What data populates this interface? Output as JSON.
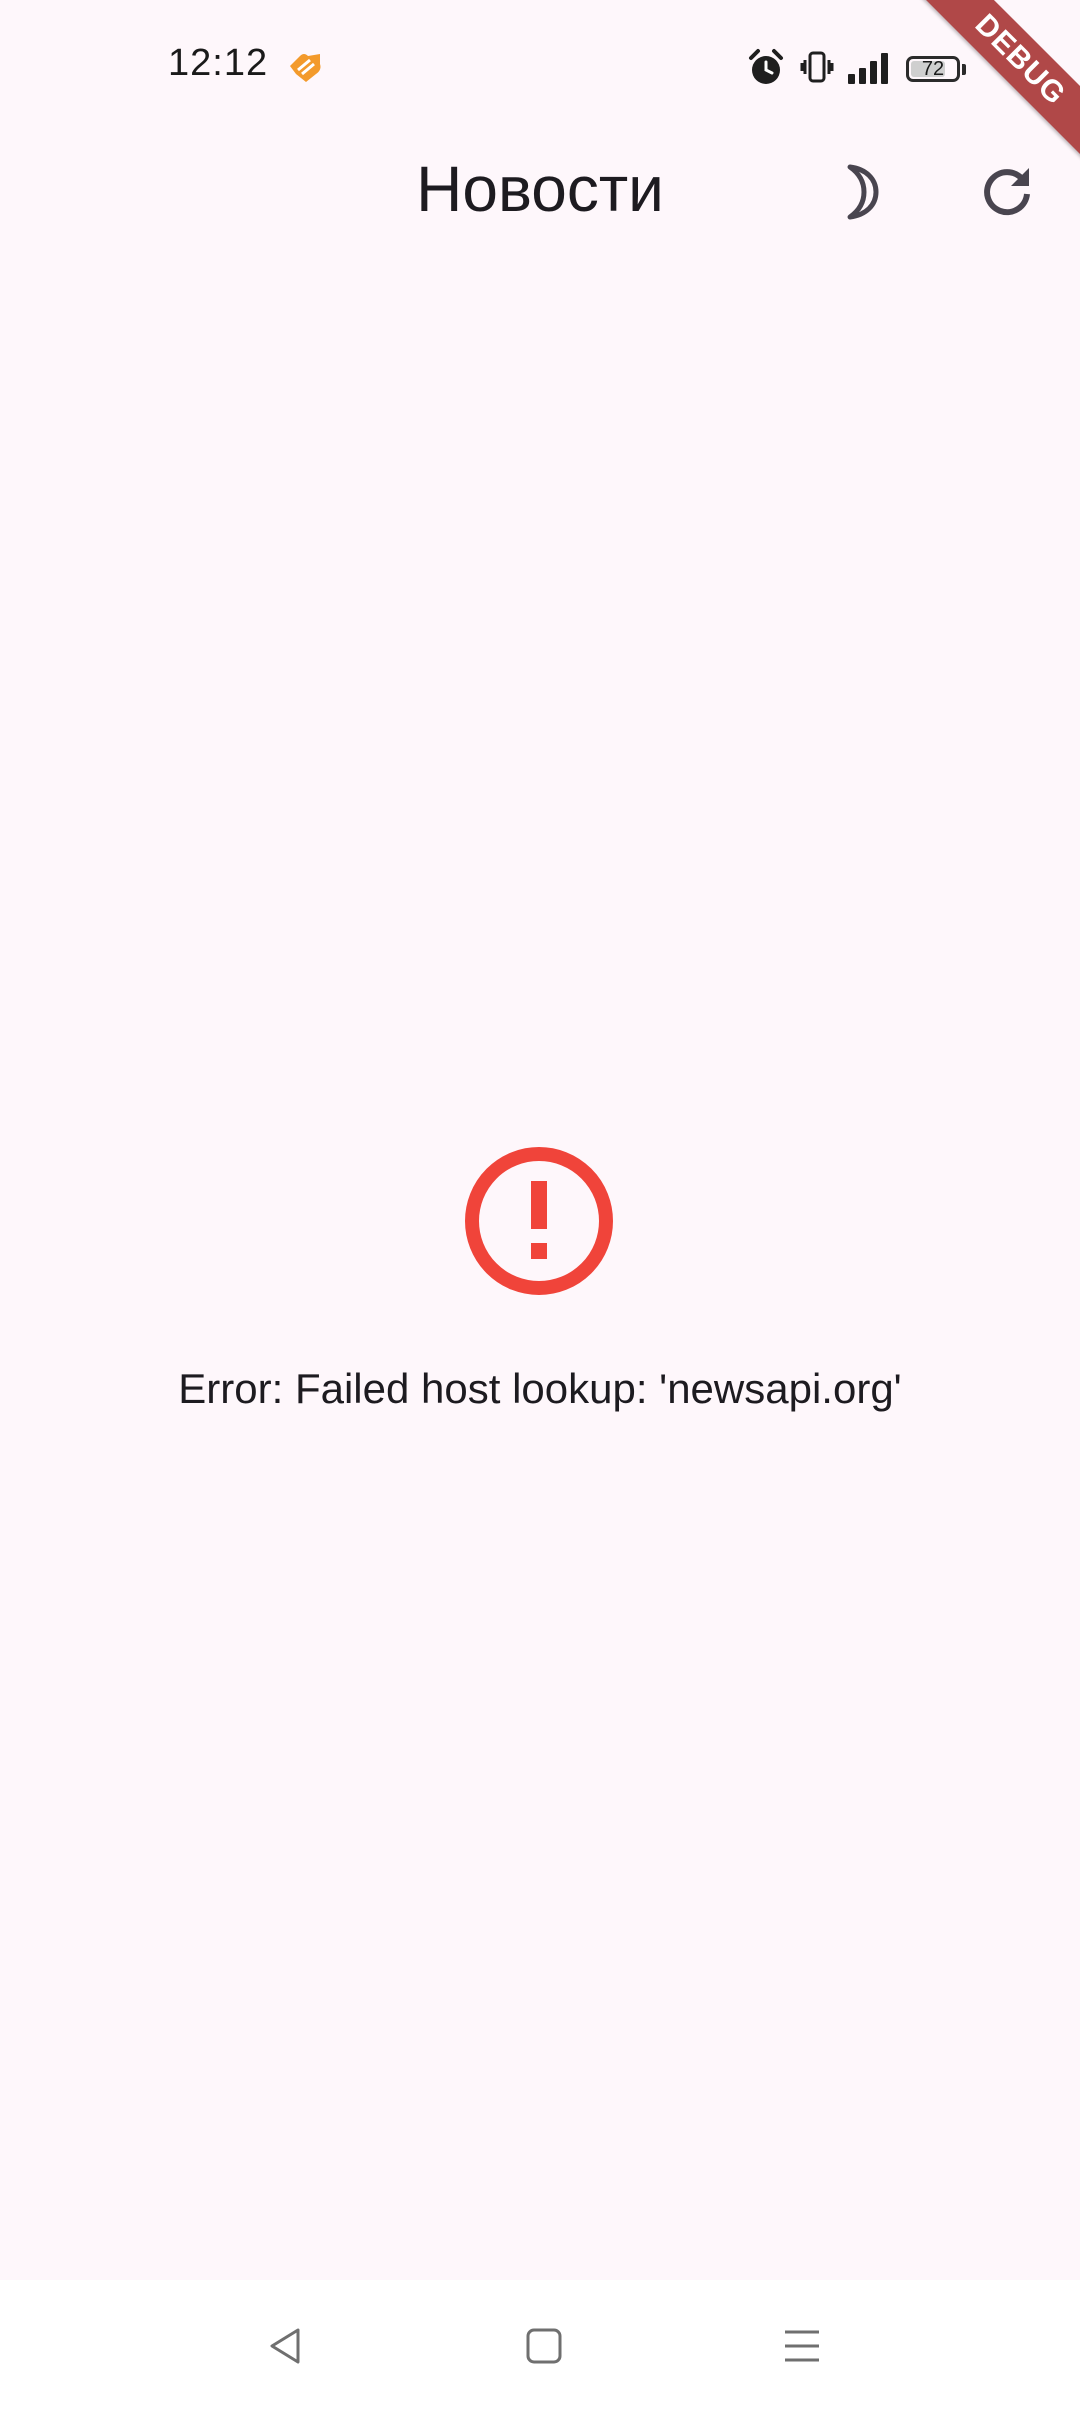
{
  "status_bar": {
    "time": "12:12",
    "battery_level": "72",
    "app_icon": "orange-app-notification-icon",
    "icons": [
      "alarm-icon",
      "vibrate-icon",
      "signal-icon",
      "battery-icon"
    ]
  },
  "debug_banner": {
    "label": "DEBUG",
    "color": "#b04848"
  },
  "app_bar": {
    "title": "Новости",
    "actions": [
      "dark-mode-moon-icon",
      "refresh-icon"
    ]
  },
  "error": {
    "icon": "error-outline-icon",
    "icon_color": "#f0443a",
    "message": "Error: Failed host lookup: 'newsapi.org'"
  },
  "navigation_bar": {
    "buttons": [
      "back-triangle-icon",
      "home-square-icon",
      "recents-menu-icon"
    ]
  },
  "colors": {
    "background": "#fef7fb",
    "text": "#1d1b20"
  }
}
